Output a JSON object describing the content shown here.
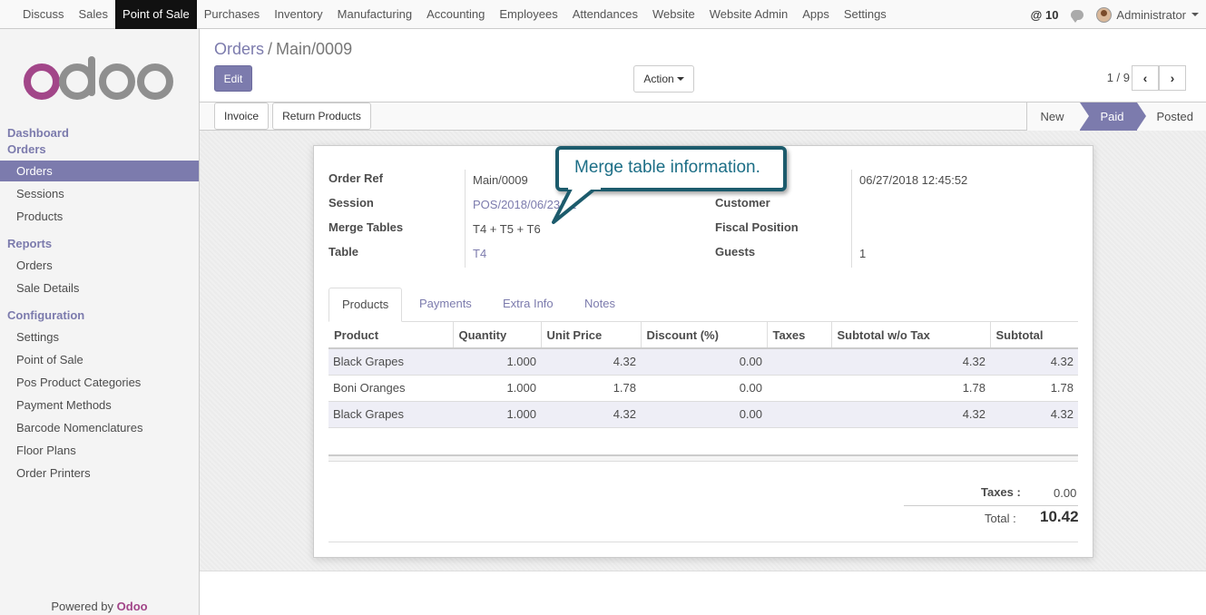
{
  "topbar": {
    "menus": [
      "Discuss",
      "Sales",
      "Point of Sale",
      "Purchases",
      "Inventory",
      "Manufacturing",
      "Accounting",
      "Employees",
      "Attendances",
      "Website",
      "Website Admin",
      "Apps",
      "Settings"
    ],
    "active_menu": "Point of Sale",
    "notifications": "@ 10",
    "user": "Administrator"
  },
  "sidebar": {
    "sections": {
      "dashboard": "Dashboard",
      "orders": "Orders",
      "reports": "Reports",
      "configuration": "Configuration"
    },
    "orders_items": [
      "Orders",
      "Sessions",
      "Products"
    ],
    "reports_items": [
      "Orders",
      "Sale Details"
    ],
    "config_items": [
      "Settings",
      "Point of Sale",
      "Pos Product Categories",
      "Payment Methods",
      "Barcode Nomenclatures",
      "Floor Plans",
      "Order Printers"
    ],
    "powered_by": "Powered by",
    "powered_brand": "Odoo"
  },
  "control_panel": {
    "breadcrumb_parent": "Orders",
    "breadcrumb_sep": "/",
    "breadcrumb_current": "Main/0009",
    "edit_label": "Edit",
    "action_label": "Action",
    "pager": "1 / 9"
  },
  "statusbar": {
    "invoice_label": "Invoice",
    "return_label": "Return Products",
    "stages": [
      "New",
      "Paid",
      "Posted"
    ],
    "current_stage": "Paid"
  },
  "form": {
    "order_ref_label": "Order Ref",
    "order_ref": "Main/0009",
    "session_label": "Session",
    "session": "POS/2018/06/23/01",
    "merge_tables_label": "Merge Tables",
    "merge_tables": "T4 + T5 + T6",
    "table_label": "Table",
    "table": "T4",
    "order_date": "06/27/2018 12:45:52",
    "customer_label": "Customer",
    "customer": "",
    "fiscal_position_label": "Fiscal Position",
    "fiscal_position": "",
    "guests_label": "Guests",
    "guests": "1"
  },
  "tabs": [
    "Products",
    "Payments",
    "Extra Info",
    "Notes"
  ],
  "lines": {
    "columns": [
      "Product",
      "Quantity",
      "Unit Price",
      "Discount (%)",
      "Taxes",
      "Subtotal w/o Tax",
      "Subtotal"
    ],
    "rows": [
      [
        "Black Grapes",
        "1.000",
        "4.32",
        "0.00",
        "",
        "4.32",
        "4.32"
      ],
      [
        "Boni Oranges",
        "1.000",
        "1.78",
        "0.00",
        "",
        "1.78",
        "1.78"
      ],
      [
        "Black Grapes",
        "1.000",
        "4.32",
        "0.00",
        "",
        "4.32",
        "4.32"
      ]
    ]
  },
  "totals": {
    "taxes_label": "Taxes :",
    "taxes": "0.00",
    "total_label": "Total :",
    "total": "10.42"
  },
  "callout": {
    "text": "Merge table information."
  },
  "colors": {
    "primary": "#7c7bad",
    "callout_border": "#1c5b6c",
    "callout_text": "#1c6e86"
  }
}
